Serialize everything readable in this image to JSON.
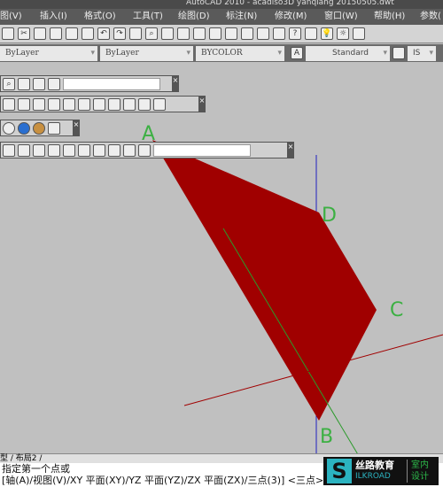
{
  "title": "AutoCAD 2010 - acadiso3D yanqiang 20150505.dwt",
  "menu": [
    "图(V)",
    "插入(I)",
    "格式(O)",
    "工具(T)",
    "绘图(D)",
    "标注(N)",
    "修改(M)",
    "窗口(W)",
    "帮助(H)",
    "参数("
  ],
  "properties": {
    "linetype": "ByLayer",
    "lineweight": "ByLayer",
    "color": "BYCOLOR",
    "text_style": "Standard",
    "dim_style": "IS"
  },
  "labels": {
    "a": "A",
    "b": "B",
    "c": "C",
    "d": "D"
  },
  "colors": {
    "face": "#a00000",
    "x_axis": "#a00000",
    "y_axis": "#2a9a2a",
    "z_axis": "#2020c0",
    "label": "#3cb043"
  },
  "tabs": [
    "型",
    "布局2"
  ],
  "command": {
    "line1": "指定第一个点或",
    "line2": "[轴(A)/视图(V)/XY 平面(XY)/YZ 平面(YZ)/ZX 平面(ZX)/三点(3)] <三点>:"
  },
  "logo": {
    "name": "丝路教育",
    "en": "ILKROAD",
    "sub1": "室内",
    "sub2": "设计"
  }
}
